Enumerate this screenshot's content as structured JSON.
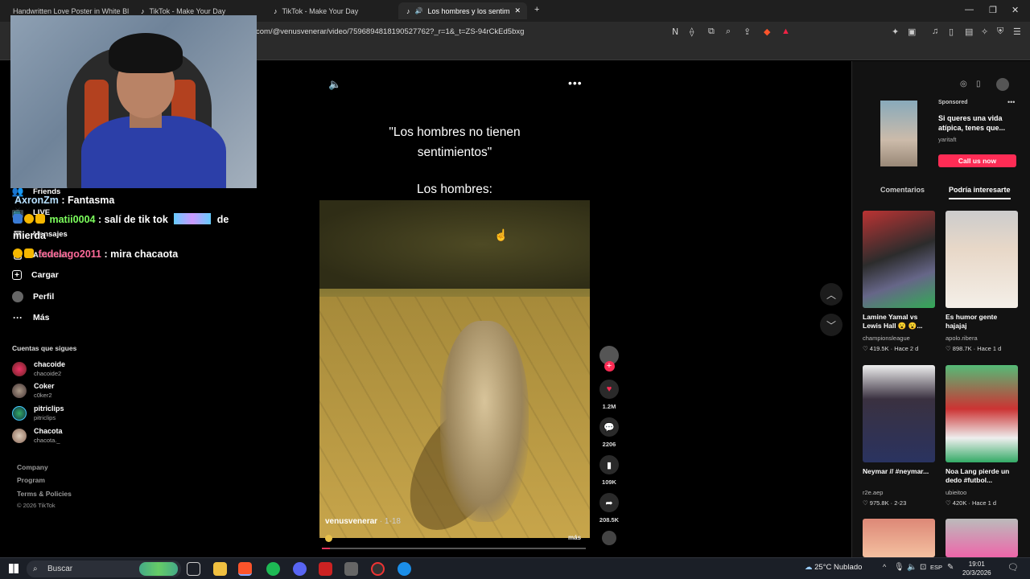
{
  "browser": {
    "tabs": [
      {
        "label": "Handwritten Love Poster in White Bl"
      },
      {
        "label": "TikTok - Make Your Day"
      },
      {
        "label": "TikTok - Make Your Day"
      },
      {
        "label": "Los hombres y los sentimient"
      }
    ],
    "url": "com/@venusvenerar/video/7596894818190527762?_r=1&_t=ZS-94rCkEd5bxg"
  },
  "nav": {
    "friends": "Friends",
    "live": "LIVE",
    "messages": "Mensajes",
    "activity": "Actividad",
    "upload": "Cargar",
    "profile": "Perfil",
    "more": "Más",
    "following_title": "Cuentas que sigues",
    "following": [
      {
        "name": "chacoide",
        "handle": "chacoide2"
      },
      {
        "name": "Coker",
        "handle": "c0ker2"
      },
      {
        "name": "pitriclips",
        "handle": "pitriclips"
      },
      {
        "name": "Chacota",
        "handle": "chacota._"
      }
    ],
    "footer": [
      "Company",
      "Program",
      "Terms & Policies",
      "© 2026 TikTok"
    ]
  },
  "chat": [
    {
      "user": "AxronZm",
      "msg": ": Fantasma"
    },
    {
      "user": "matii0004",
      "msg": ": salí de tik tok",
      "msg2": "de"
    },
    {
      "cont": "mierda"
    },
    {
      "user": "fedelago2011",
      "msg": ": mira chacaota"
    }
  ],
  "video": {
    "caption_line1": "\"Los hombres no tienen",
    "caption_line2": "sentimientos\"",
    "caption_line3": "Los hombres:",
    "author": "venusvenerar",
    "date": " · 1-18",
    "more": "más",
    "progress": 0.03,
    "likes": "1.2M",
    "comments": "2206",
    "saves": "109K",
    "shares": "208.5K"
  },
  "right": {
    "sponsored": "Sponsored",
    "ad_text": "Si queres una vida atípica, tenes que...",
    "ad_author": "yaritaft",
    "ad_cta": "Call us now",
    "tab_comments": "Comentarios",
    "tab_interesting": "Podría interesarte",
    "cards": [
      {
        "title": "Lamine Yamal vs Lewis Hall 😮 😮...",
        "author": "championsleague",
        "stats": "♡ 419.5K · Hace 2 d"
      },
      {
        "title": "Es humor gente hajajaj",
        "author": "apolo.ribera",
        "stats": "♡ 898.7K · Hace 1 d"
      },
      {
        "title": "Neymar // #neymar...",
        "author": "r2e.aep",
        "stats": "♡ 975.8K · 2-23"
      },
      {
        "title": "Noa Lang pierde un dedo #futbol...",
        "author": "ubieitoo",
        "stats": "♡ 420K · Hace 1 d"
      }
    ]
  },
  "taskbar": {
    "search": "Buscar",
    "weather": "25°C  Nublado",
    "lang": "ESP",
    "time": "19:01",
    "date": "20/3/2026"
  }
}
